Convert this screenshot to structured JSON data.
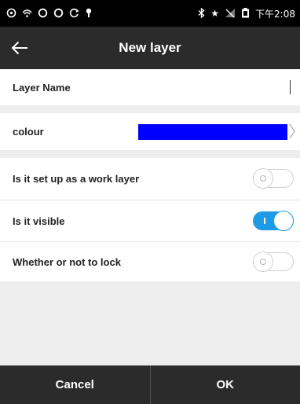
{
  "status_bar": {
    "left_icons": [
      "chat-icon",
      "signal-icon",
      "sync-icon",
      "sync-icon",
      "gear-icon",
      "location-icon"
    ],
    "right_icons": [
      "bluetooth-icon",
      "star-icon",
      "no-signal-icon",
      "battery-icon"
    ],
    "time": "下午2:08"
  },
  "app_bar": {
    "title": "New layer",
    "back_icon": "arrow-left-icon"
  },
  "form": {
    "layer_name_label": "Layer Name",
    "layer_name_value": "",
    "colour_label": "colour",
    "colour_value": "#0000ff",
    "work_layer_label": "Is it set up as a work layer",
    "work_layer_on": false,
    "visible_label": "Is it visible",
    "visible_on": true,
    "lock_label": "Whether or not to lock",
    "lock_on": false
  },
  "actions": {
    "cancel_label": "Cancel",
    "ok_label": "OK"
  },
  "colors": {
    "toggle_on": "#1e9be6",
    "bar": "#2b2b2b",
    "background": "#ededed"
  }
}
